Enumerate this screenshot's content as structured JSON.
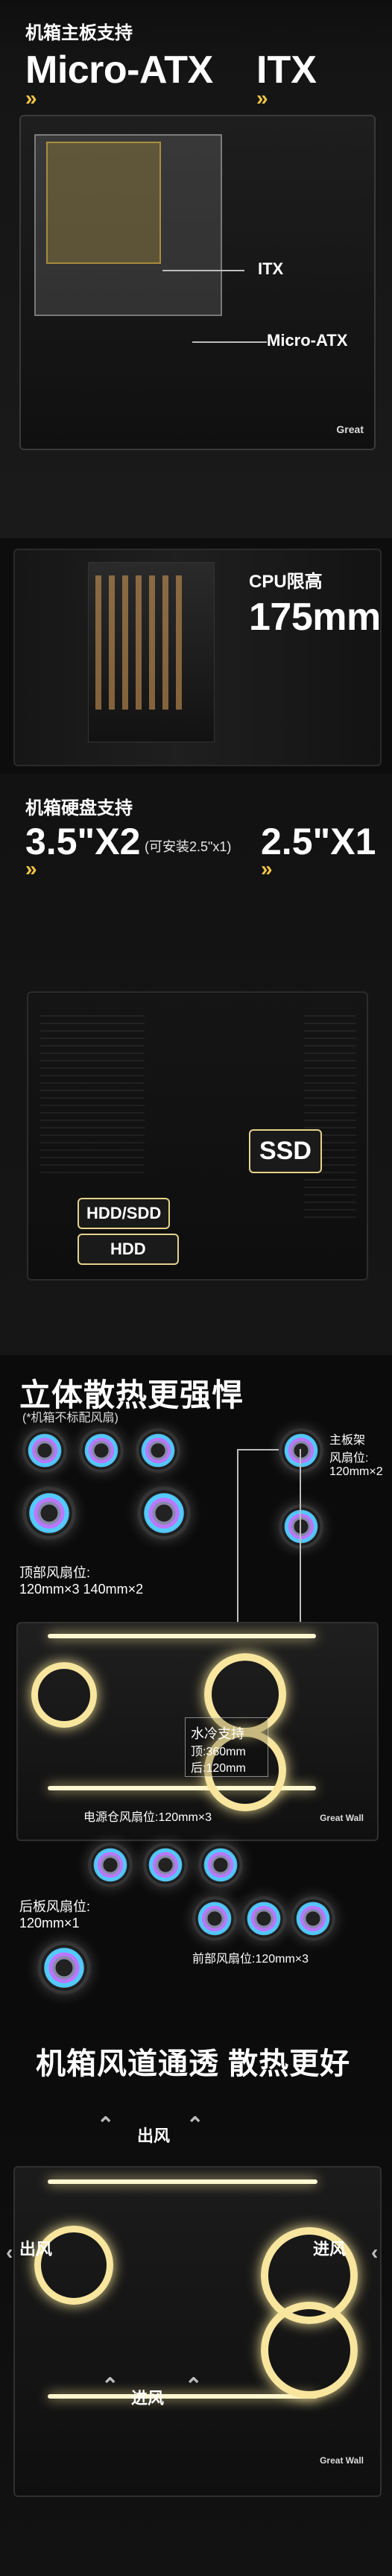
{
  "panel1": {
    "title": "机箱主板支持",
    "left_big": "Micro-ATX",
    "right_big": "ITX",
    "callouts": [
      "ITX",
      "Micro-ATX"
    ],
    "brand_text": "Great"
  },
  "panel2": {
    "cpu_label": "CPU限高",
    "cpu_value": "175mm"
  },
  "panel3": {
    "title": "机箱硬盘支持",
    "hdd_left_value": "3.5\"X2",
    "hdd_left_note": "(可安装2.5\"x1)",
    "hdd_right_value": "2.5\"X1",
    "badges": {
      "ssd": "SSD",
      "hdd_ssd": "HDD/SDD",
      "hdd": "HDD"
    }
  },
  "panel4": {
    "title": "立体散热更强悍",
    "subtitle": "(*机箱不标配风扇)",
    "top_label_1": "顶部风扇位:",
    "top_label_2": "120mm×3   140mm×2",
    "mb_label_1": "主板架",
    "mb_label_2": "风扇位:",
    "mb_label_3": "120mm×2",
    "water_1": "水冷支持",
    "water_2": "顶:360mm",
    "water_3": "后:120mm",
    "psu_label": "电源仓风扇位:120mm×3",
    "rear_1": "后板风扇位:",
    "rear_2": "120mm×1",
    "front_label": "前部风扇位:120mm×3",
    "brand_small": "Great Wall"
  },
  "panel5": {
    "title": "机箱风道通透 散热更好",
    "out_top": "出风",
    "out_left": "出风",
    "in_right": "进风",
    "in_bottom": "进风",
    "brand_small": "Great Wall"
  }
}
